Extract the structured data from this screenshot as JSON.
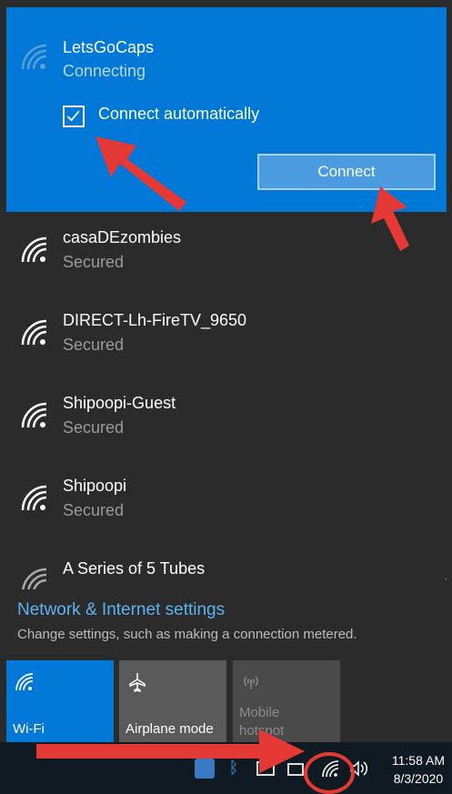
{
  "selected_network": {
    "ssid": "LetsGoCaps",
    "status": "Connecting",
    "auto_connect_label": "Connect automatically",
    "auto_connect_checked": true,
    "connect_label": "Connect"
  },
  "networks": [
    {
      "ssid": "casaDEzombies",
      "status": "Secured"
    },
    {
      "ssid": "DIRECT-Lh-FireTV_9650",
      "status": "Secured"
    },
    {
      "ssid": "Shipoopi-Guest",
      "status": "Secured"
    },
    {
      "ssid": "Shipoopi",
      "status": "Secured"
    },
    {
      "ssid": "A Series of 5 Tubes",
      "status": ""
    }
  ],
  "settings": {
    "link": "Network & Internet settings",
    "description": "Change settings, such as making a connection metered."
  },
  "quick_actions": [
    {
      "label": "Wi-Fi",
      "icon": "wifi-icon",
      "active": true
    },
    {
      "label": "Airplane mode",
      "icon": "airplane-icon",
      "active": false
    },
    {
      "label": "Mobile hotspot",
      "label_line1": "Mobile",
      "label_line2": "hotspot",
      "icon": "hotspot-icon",
      "active": false,
      "disabled": true
    }
  ],
  "taskbar": {
    "time": "11:58 AM",
    "date": "8/3/2020"
  },
  "colors": {
    "accent": "#0078d7",
    "flyout_bg": "#2b2b2b",
    "annotation": "#e53935"
  }
}
